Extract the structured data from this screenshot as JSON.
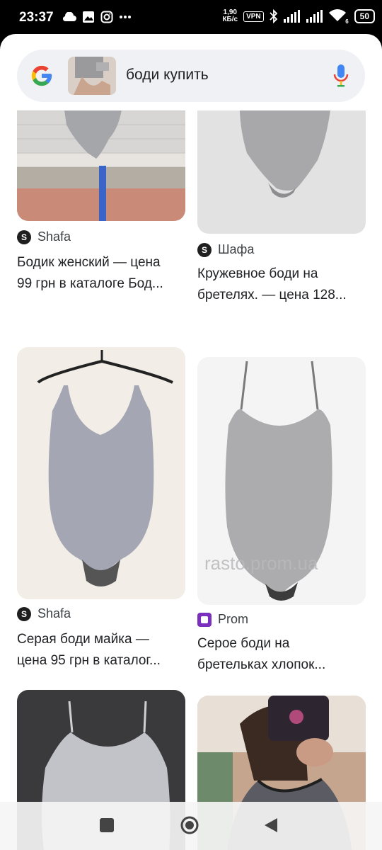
{
  "status_bar": {
    "time": "23:37",
    "net_speed_value": "1,90",
    "net_speed_unit": "КБ/с",
    "vpn_label": "VPN",
    "battery": "50",
    "network_type": "6"
  },
  "search": {
    "query": "боди купить"
  },
  "results": [
    {
      "source": "Shafa",
      "title_line1": "Бодик женский — цена",
      "title_line2": "99 грн в каталоге Бод..."
    },
    {
      "source": "Шафа",
      "title_line1": "Кружевное боди на",
      "title_line2": "бретелях. — цена 128..."
    },
    {
      "source": "Shafa",
      "title_line1": "Серая боди майка —",
      "title_line2": "цена 95 грн в каталог..."
    },
    {
      "source": "Prom",
      "title_line1": "Серое боди на",
      "title_line2": "бретельках хлопок..."
    }
  ],
  "watermark": "rasto.prom.ua",
  "colors": {
    "google_blue": "#4285F4",
    "google_red": "#EA4335",
    "google_yellow": "#FBBC05",
    "google_green": "#34A853",
    "prom_purple": "#7b2fbf"
  }
}
